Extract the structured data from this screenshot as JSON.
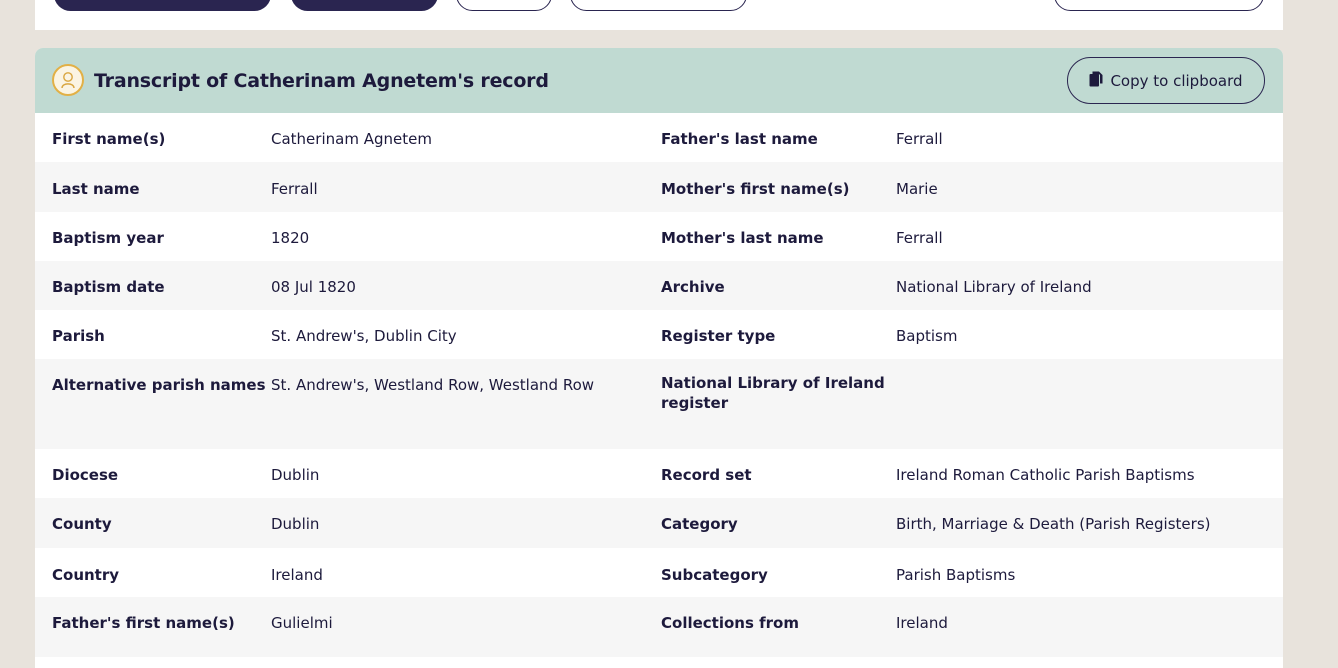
{
  "card": {
    "title": "Transcript of Catherinam Agnetem's record",
    "copy_label": "Copy to clipboard"
  },
  "icons": {
    "record": "person-silhouette-icon",
    "copy": "document-copy-icon"
  },
  "rows": [
    {
      "l1": "First name(s)",
      "v1": "Catherinam Agnetem",
      "l2": "Father's last name",
      "v2": "Ferrall"
    },
    {
      "l1": "Last name",
      "v1": "Ferrall",
      "l2": "Mother's first name(s)",
      "v2": "Marie"
    },
    {
      "l1": "Baptism year",
      "v1": "1820",
      "l2": "Mother's last name",
      "v2": "Ferrall"
    },
    {
      "l1": "Baptism date",
      "v1": "08 Jul 1820",
      "l2": "Archive",
      "v2": "National Library of Ireland"
    },
    {
      "l1": "Parish",
      "v1": "St. Andrew's, Dublin City",
      "l2": "Register type",
      "v2": "Baptism"
    },
    {
      "l1": "Alternative parish names",
      "v1": "St. Andrew's, Westland Row, Westland Row",
      "l2": "National Library of Ireland register",
      "v2": "http://registers.nli.ie//registers/vtls000633483#page/1/mode/1up"
    },
    {
      "l1": "Diocese",
      "v1": "Dublin",
      "l2": "Record set",
      "v2": "Ireland Roman Catholic Parish Baptisms"
    },
    {
      "l1": "County",
      "v1": "Dublin",
      "l2": "Category",
      "v2": "Birth, Marriage & Death (Parish Registers)"
    },
    {
      "l1": "Country",
      "v1": "Ireland",
      "l2": "Subcategory",
      "v2": "Parish Baptisms"
    },
    {
      "l1": "Father's first name(s)",
      "v1": "Gulielmi",
      "l2": "Collections from",
      "v2": "Ireland"
    }
  ],
  "colors": {
    "header_bg": "#c0dad2",
    "page_bg": "#e8e3dc",
    "text": "#1d1a3c",
    "link": "#2a4db0",
    "icon_ring": "#e2b046"
  }
}
